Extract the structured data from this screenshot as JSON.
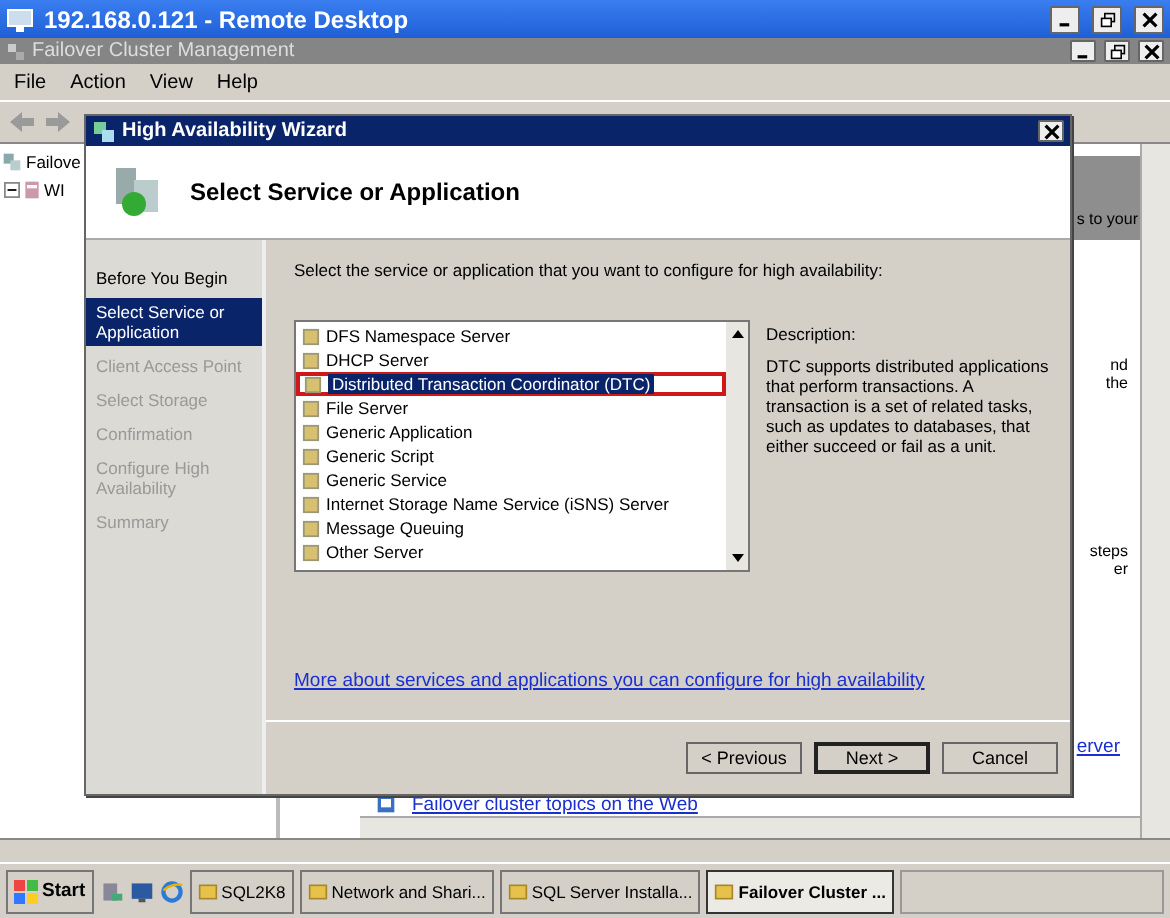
{
  "remote_window": {
    "title": "192.168.0.121 - Remote Desktop"
  },
  "app_window": {
    "title": "Failover Cluster Management",
    "menu": [
      "File",
      "Action",
      "View",
      "Help"
    ]
  },
  "tree": [
    {
      "label": "Failove",
      "children": [
        {
          "label": "WI"
        }
      ]
    }
  ],
  "background_pane": {
    "fragments": [
      "s to your",
      "nd",
      "the",
      "steps",
      "er"
    ],
    "link": "erver",
    "web_link": "Failover cluster topics on the Web"
  },
  "wizard": {
    "title": "High Availability Wizard",
    "heading": "Select Service or Application",
    "steps": [
      {
        "label": "Before You Begin",
        "selected": false,
        "disabled": false
      },
      {
        "label": "Select Service or Application",
        "selected": true,
        "disabled": false
      },
      {
        "label": "Client Access Point",
        "selected": false,
        "disabled": true
      },
      {
        "label": "Select Storage",
        "selected": false,
        "disabled": true
      },
      {
        "label": "Confirmation",
        "selected": false,
        "disabled": true
      },
      {
        "label": "Configure High Availability",
        "selected": false,
        "disabled": true
      },
      {
        "label": "Summary",
        "selected": false,
        "disabled": true
      }
    ],
    "instruction": "Select the service or application that you want to configure for high availability:",
    "services": [
      {
        "label": "DFS Namespace Server",
        "selected": false,
        "annotated": false
      },
      {
        "label": "DHCP Server",
        "selected": false,
        "annotated": false
      },
      {
        "label": "Distributed Transaction Coordinator (DTC)",
        "selected": true,
        "annotated": true
      },
      {
        "label": "File Server",
        "selected": false,
        "annotated": false
      },
      {
        "label": "Generic Application",
        "selected": false,
        "annotated": false
      },
      {
        "label": "Generic Script",
        "selected": false,
        "annotated": false
      },
      {
        "label": "Generic Service",
        "selected": false,
        "annotated": false
      },
      {
        "label": "Internet Storage Name Service (iSNS) Server",
        "selected": false,
        "annotated": false
      },
      {
        "label": "Message Queuing",
        "selected": false,
        "annotated": false
      },
      {
        "label": "Other Server",
        "selected": false,
        "annotated": false
      }
    ],
    "description_label": "Description:",
    "description": "DTC supports distributed applications that perform transactions. A transaction is a set of related tasks, such as updates to databases, that either succeed or fail as a unit.",
    "link": "More about services and applications you can configure for high availability",
    "buttons": [
      {
        "label": "< Previous",
        "default": false
      },
      {
        "label": "Next >",
        "default": true
      },
      {
        "label": "Cancel",
        "default": false
      }
    ]
  },
  "taskbar": {
    "start": "Start",
    "tasks": [
      {
        "label": "SQL2K8",
        "selected": false
      },
      {
        "label": "Network and Shari...",
        "selected": false
      },
      {
        "label": "SQL Server Installa...",
        "selected": false
      },
      {
        "label": "Failover Cluster ...",
        "selected": true
      }
    ]
  }
}
